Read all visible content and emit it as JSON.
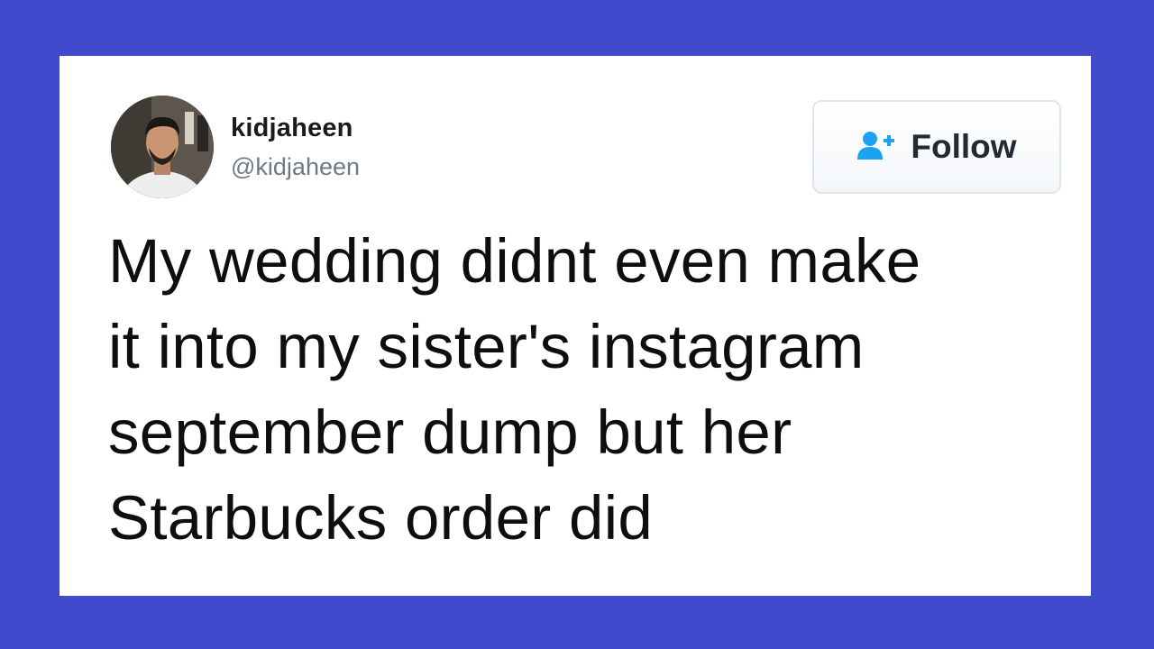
{
  "user": {
    "display_name": "kidjaheen",
    "handle": "@kidjaheen",
    "avatar_icon": "profile-photo"
  },
  "follow_button": {
    "label": "Follow",
    "icon": "add-user-icon",
    "icon_color": "#1da1f2"
  },
  "tweet": {
    "lines": [
      "My wedding didnt even make",
      "it into my sister's instagram",
      "september dump but her",
      "Starbucks order did"
    ]
  },
  "colors": {
    "background": "#4149cc",
    "card": "#ffffff",
    "text": "#0e0e0e",
    "handle": "#6f7a86"
  }
}
